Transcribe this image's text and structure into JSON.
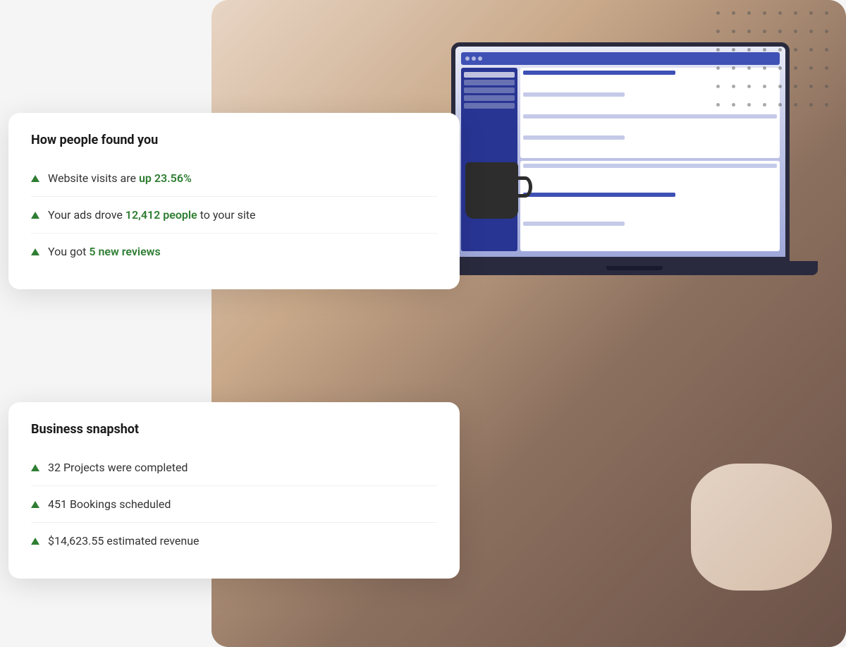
{
  "scene": {
    "dot_pattern_count": 48
  },
  "card_top": {
    "title": "How people found you",
    "items": [
      {
        "id": "website-visits",
        "text_before": "Website visits are ",
        "highlight": "up 23.56%",
        "text_after": ""
      },
      {
        "id": "ads-drove",
        "text_before": "Your ads drove ",
        "highlight": "12,412 people",
        "text_after": " to your site"
      },
      {
        "id": "new-reviews",
        "text_before": "You got ",
        "highlight": "5 new reviews",
        "text_after": ""
      }
    ]
  },
  "card_bottom": {
    "title": "Business snapshot",
    "items": [
      {
        "id": "projects",
        "text_before": "32 Projects were completed",
        "highlight": "",
        "text_after": ""
      },
      {
        "id": "bookings",
        "text_before": "451 Bookings scheduled",
        "highlight": "",
        "text_after": ""
      },
      {
        "id": "revenue",
        "text_before": "$14,623.55 estimated revenue",
        "highlight": "",
        "text_after": ""
      }
    ]
  }
}
